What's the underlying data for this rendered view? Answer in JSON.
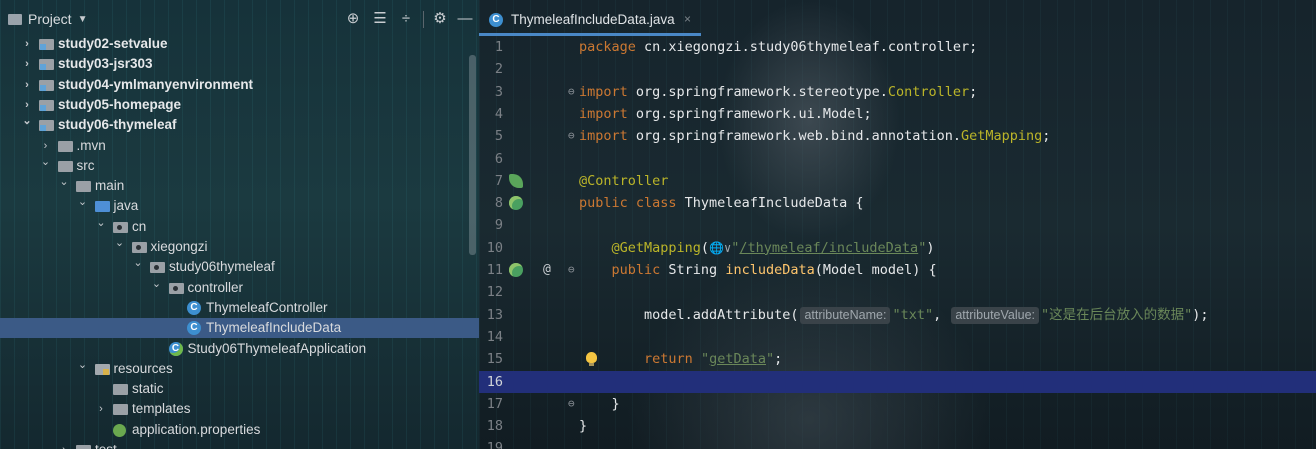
{
  "project_panel": {
    "title": "Project",
    "tools": [
      "target-icon",
      "expand-all-icon",
      "collapse-all-icon",
      "gear-icon",
      "minimize-icon"
    ],
    "tree": [
      {
        "label": "study02-setvalue",
        "depth": 1,
        "arrow": ">",
        "icon": "module",
        "bold": true
      },
      {
        "label": "study03-jsr303",
        "depth": 1,
        "arrow": ">",
        "icon": "module",
        "bold": true
      },
      {
        "label": "study04-ymlmanyenvironment",
        "depth": 1,
        "arrow": ">",
        "icon": "module",
        "bold": true
      },
      {
        "label": "study05-homepage",
        "depth": 1,
        "arrow": ">",
        "icon": "module",
        "bold": true
      },
      {
        "label": "study06-thymeleaf",
        "depth": 1,
        "arrow": "v",
        "icon": "module",
        "bold": true
      },
      {
        "label": ".mvn",
        "depth": 2,
        "arrow": ">",
        "icon": "folder"
      },
      {
        "label": "src",
        "depth": 2,
        "arrow": "v",
        "icon": "folder"
      },
      {
        "label": "main",
        "depth": 3,
        "arrow": "v",
        "icon": "folder"
      },
      {
        "label": "java",
        "depth": 4,
        "arrow": "v",
        "icon": "java"
      },
      {
        "label": "cn",
        "depth": 5,
        "arrow": "v",
        "icon": "package"
      },
      {
        "label": "xiegongzi",
        "depth": 6,
        "arrow": "v",
        "icon": "package"
      },
      {
        "label": "study06thymeleaf",
        "depth": 7,
        "arrow": "v",
        "icon": "package"
      },
      {
        "label": "controller",
        "depth": 8,
        "arrow": "v",
        "icon": "package"
      },
      {
        "label": "ThymeleafController",
        "depth": 9,
        "arrow": "",
        "icon": "class"
      },
      {
        "label": "ThymeleafIncludeData",
        "depth": 9,
        "arrow": "",
        "icon": "class",
        "selected": true
      },
      {
        "label": "Study06ThymeleafApplication",
        "depth": 8,
        "arrow": "",
        "icon": "app"
      },
      {
        "label": "resources",
        "depth": 4,
        "arrow": "v",
        "icon": "resources"
      },
      {
        "label": "static",
        "depth": 5,
        "arrow": "",
        "icon": "folder"
      },
      {
        "label": "templates",
        "depth": 5,
        "arrow": ">",
        "icon": "folder"
      },
      {
        "label": "application.properties",
        "depth": 5,
        "arrow": "",
        "icon": "properties"
      },
      {
        "label": "test",
        "depth": 3,
        "arrow": ">",
        "icon": "folder"
      }
    ]
  },
  "editor": {
    "tab": {
      "label": "ThymeleafIncludeData.java",
      "close": "×"
    },
    "current_line": 16,
    "lines": [
      {
        "n": "1",
        "parts": [
          [
            "kw",
            "package "
          ],
          [
            "pl",
            "cn.xiegongzi.study06thymeleaf.controller;"
          ]
        ]
      },
      {
        "n": "2",
        "parts": []
      },
      {
        "n": "3",
        "fold": "⊖",
        "parts": [
          [
            "kw",
            "import "
          ],
          [
            "pl",
            "org.springframework.stereotype."
          ],
          [
            "ann",
            "Controller"
          ],
          [
            "pl",
            ";"
          ]
        ]
      },
      {
        "n": "4",
        "parts": [
          [
            "kw",
            "import "
          ],
          [
            "pl",
            "org.springframework.ui.Model;"
          ]
        ]
      },
      {
        "n": "5",
        "fold": "⊖",
        "parts": [
          [
            "kw",
            "import "
          ],
          [
            "pl",
            "org.springframework.web.bind.annotation."
          ],
          [
            "ann",
            "GetMapping"
          ],
          [
            "pl",
            ";"
          ]
        ]
      },
      {
        "n": "6",
        "parts": []
      },
      {
        "n": "7",
        "gutter": "leaf",
        "parts": [
          [
            "ann",
            "@Controller"
          ]
        ]
      },
      {
        "n": "8",
        "gutter": "bean",
        "parts": [
          [
            "kw",
            "public class "
          ],
          [
            "pl",
            "ThymeleafIncludeData {"
          ]
        ]
      },
      {
        "n": "9",
        "parts": []
      },
      {
        "n": "10",
        "parts": [
          [
            "pl",
            "    "
          ],
          [
            "ann",
            "@GetMapping"
          ],
          [
            "pl",
            "("
          ],
          [
            "globe",
            "🌐∨"
          ],
          [
            "str",
            "\""
          ],
          [
            "strl",
            "/thymeleaf/includeData"
          ],
          [
            "str",
            "\""
          ],
          [
            "pl",
            ")"
          ]
        ]
      },
      {
        "n": "11",
        "gutter": "bean",
        "at": "@",
        "fold": "⊖",
        "parts": [
          [
            "pl",
            "    "
          ],
          [
            "kw",
            "public "
          ],
          [
            "pl",
            "String "
          ],
          [
            "fn",
            "includeData"
          ],
          [
            "pl",
            "(Model model) {"
          ]
        ]
      },
      {
        "n": "12",
        "parts": []
      },
      {
        "n": "13",
        "parts": [
          [
            "pl",
            "        model.addAttribute("
          ],
          [
            "hint",
            "attributeName:"
          ],
          [
            "str",
            "\"txt\""
          ],
          [
            "pl",
            ", "
          ],
          [
            "hint",
            "attributeValue:"
          ],
          [
            "str",
            "\"这是在后台放入的数据\""
          ],
          [
            "pl",
            ");"
          ]
        ]
      },
      {
        "n": "14",
        "parts": []
      },
      {
        "n": "15",
        "bulb": true,
        "parts": [
          [
            "pl",
            "        "
          ],
          [
            "kw",
            "return "
          ],
          [
            "str",
            "\""
          ],
          [
            "strl",
            "getData"
          ],
          [
            "str",
            "\""
          ],
          [
            "pl",
            ";"
          ]
        ]
      },
      {
        "n": "16",
        "parts": []
      },
      {
        "n": "17",
        "fold": "⊖",
        "parts": [
          [
            "pl",
            "    }"
          ]
        ]
      },
      {
        "n": "18",
        "parts": [
          [
            "pl",
            "}"
          ]
        ]
      },
      {
        "n": "19",
        "parts": []
      }
    ]
  }
}
